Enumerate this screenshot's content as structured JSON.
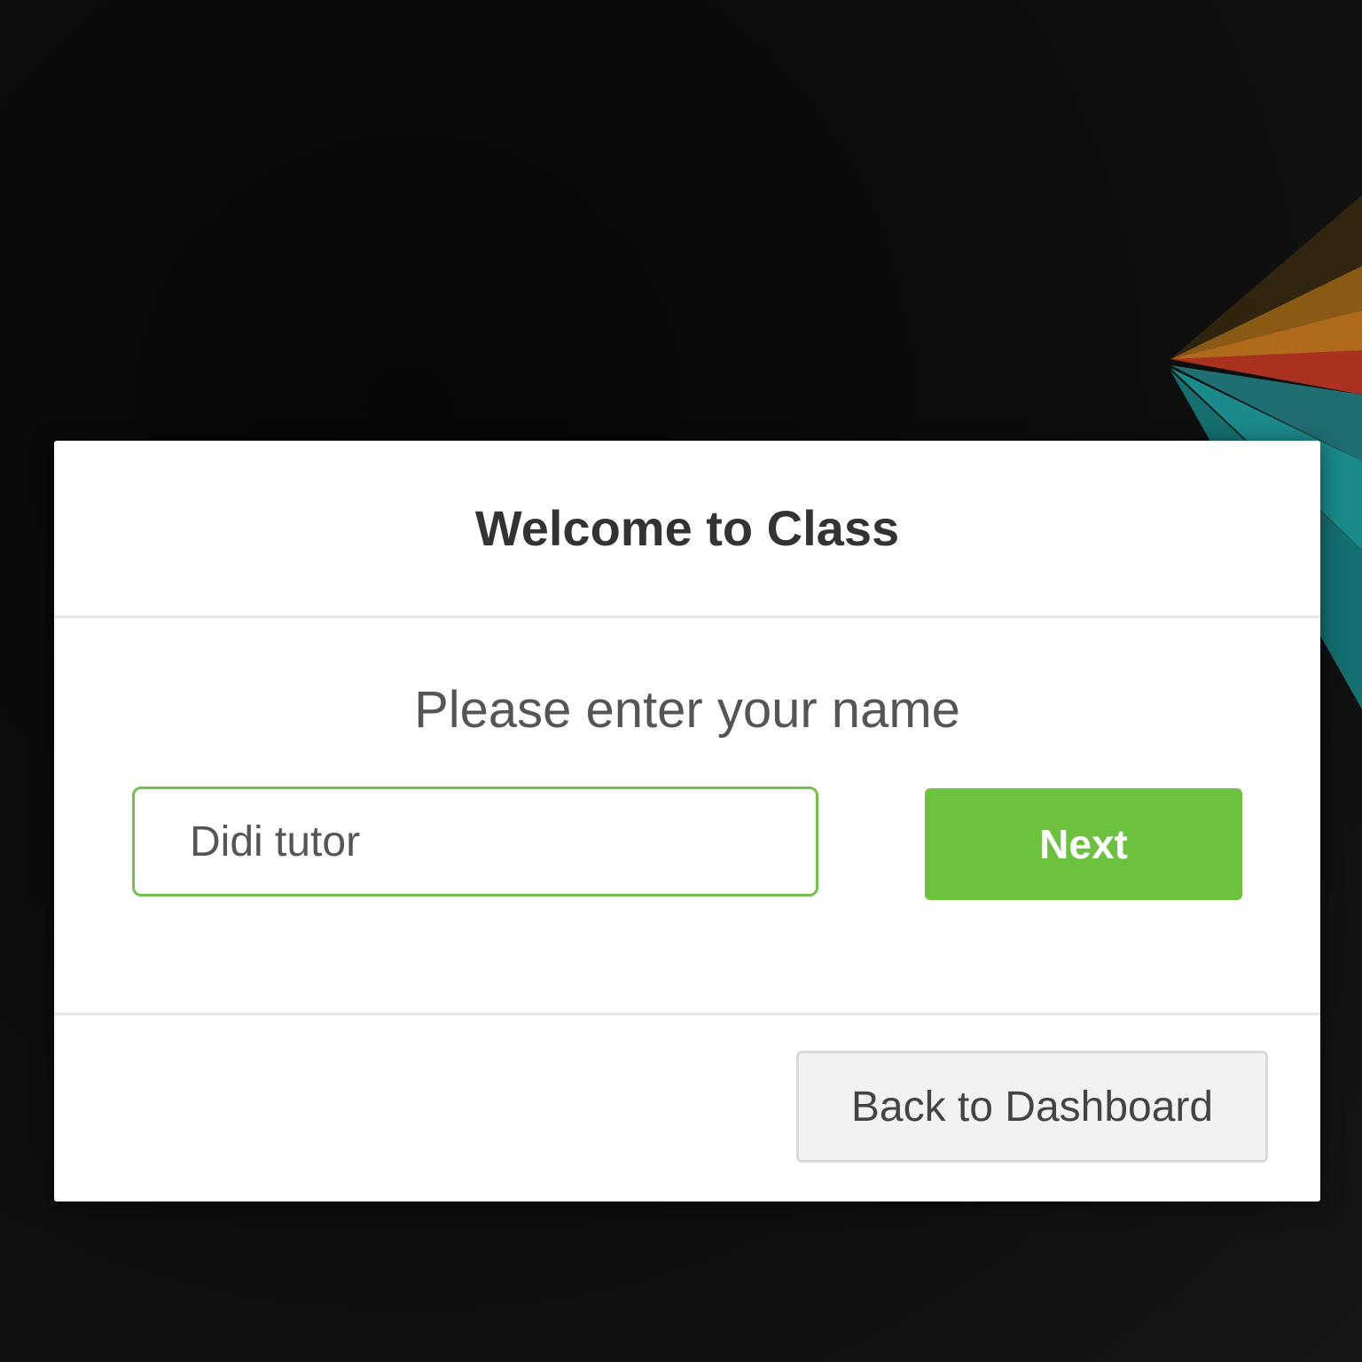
{
  "colors": {
    "accent_green": "#6cc13f",
    "input_border": "#72c14a",
    "title_text": "#333333",
    "body_text": "#555555",
    "background": "#0c0c0c"
  },
  "dialog": {
    "title": "Welcome to Class",
    "prompt": "Please enter your name",
    "name_input": {
      "value": "Didi tutor"
    },
    "next_label": "Next",
    "back_label": "Back to Dashboard"
  }
}
